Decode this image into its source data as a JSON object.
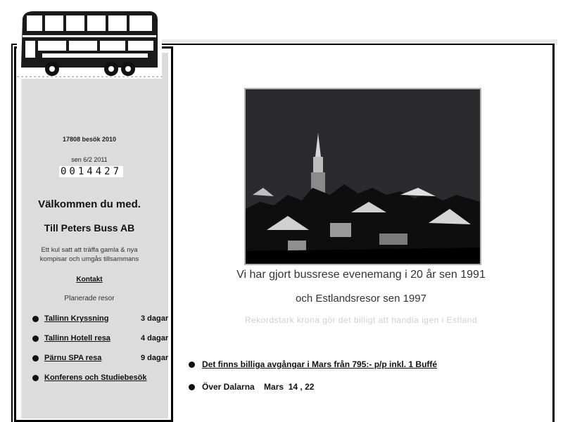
{
  "sidebar": {
    "visit_count": "17808 besök 2010",
    "since": "sen 6/2 2011",
    "counter": "0014427",
    "welcome": "Välkommen du med.",
    "company": "Till Peters Buss AB",
    "tagline_1": "Ett kul satt att träffa  gamla & nya",
    "tagline_2": "kompisar och umgås tillsammans",
    "contact_label": "Kontakt",
    "planned_label": "Planerade resor",
    "trips": [
      {
        "name": "Tallinn  Kryssning",
        "days": "3 dagar"
      },
      {
        "name": "Tallinn Hotell resa",
        "days": "4 dagar"
      },
      {
        "name": "Pärnu  SPA resa",
        "days": "9 dagar"
      },
      {
        "name": "Konferens och Studiebesök",
        "days": ""
      }
    ]
  },
  "main": {
    "line1": "Vi har gjort bussrese evenemang i 20 år sen 1991",
    "line2": "och Estlandsresor sen 1997",
    "line3": "Rekordstark krona gör det billigt att handla igen i Estland",
    "bullets": [
      {
        "text": "Det finns billiga avgångar  i  Mars från 795:- p/p  inkl. 1 Buffé",
        "underline": true
      },
      {
        "text": "Över Dalarna    Mars  14 , 22",
        "underline": false
      }
    ]
  }
}
